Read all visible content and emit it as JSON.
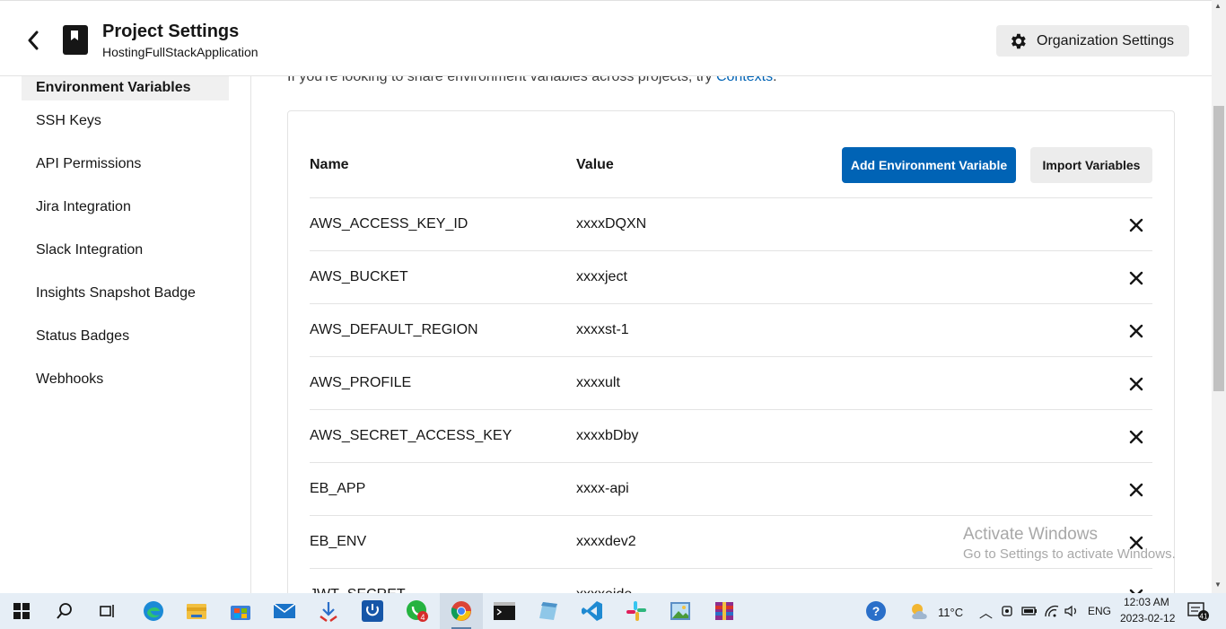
{
  "header": {
    "title": "Project Settings",
    "subtitle": "HostingFullStackApplication",
    "org_settings_label": "Organization Settings"
  },
  "sidebar": {
    "items": [
      {
        "label": "Environment Variables",
        "active": true
      },
      {
        "label": "SSH Keys"
      },
      {
        "label": "API Permissions"
      },
      {
        "label": "Jira Integration"
      },
      {
        "label": "Slack Integration"
      },
      {
        "label": "Insights Snapshot Badge"
      },
      {
        "label": "Status Badges"
      },
      {
        "label": "Webhooks"
      }
    ]
  },
  "main": {
    "intro_text": "If you're looking to share environment variables across projects, try ",
    "intro_link": "Contexts",
    "intro_end": ".",
    "table": {
      "col_name": "Name",
      "col_value": "Value",
      "add_button": "Add Environment Variable",
      "import_button": "Import Variables",
      "rows": [
        {
          "name": "AWS_ACCESS_KEY_ID",
          "value": "xxxxDQXN"
        },
        {
          "name": "AWS_BUCKET",
          "value": "xxxxject"
        },
        {
          "name": "AWS_DEFAULT_REGION",
          "value": "xxxxst-1"
        },
        {
          "name": "AWS_PROFILE",
          "value": "xxxxult"
        },
        {
          "name": "AWS_SECRET_ACCESS_KEY",
          "value": "xxxxbDby"
        },
        {
          "name": "EB_APP",
          "value": "xxxx-api"
        },
        {
          "name": "EB_ENV",
          "value": "xxxxdev2"
        },
        {
          "name": "JWT_SECRET",
          "value": "xxxxeide"
        }
      ]
    }
  },
  "watermark": {
    "line1": "Activate Windows",
    "line2": "Go to Settings to activate Windows."
  },
  "taskbar": {
    "weather_temp": "11°C",
    "language": "ENG",
    "time": "12:03 AM",
    "date": "2023-02-12",
    "notification_count": "41",
    "whatsapp_badge": "4",
    "icons": [
      "windows-start-icon",
      "search-icon",
      "task-view-icon",
      "edge-icon",
      "file-explorer-icon",
      "store-icon",
      "mail-icon",
      "download-app-icon",
      "power-app-icon",
      "whatsapp-icon",
      "chrome-icon",
      "terminal-icon",
      "notepad-icon",
      "vscode-icon",
      "slack-icon",
      "photos-icon",
      "archive-icon"
    ]
  },
  "colors": {
    "accent": "#0063b5",
    "link": "#0063b5",
    "sidebar_active_bg": "#f0f0f0"
  }
}
